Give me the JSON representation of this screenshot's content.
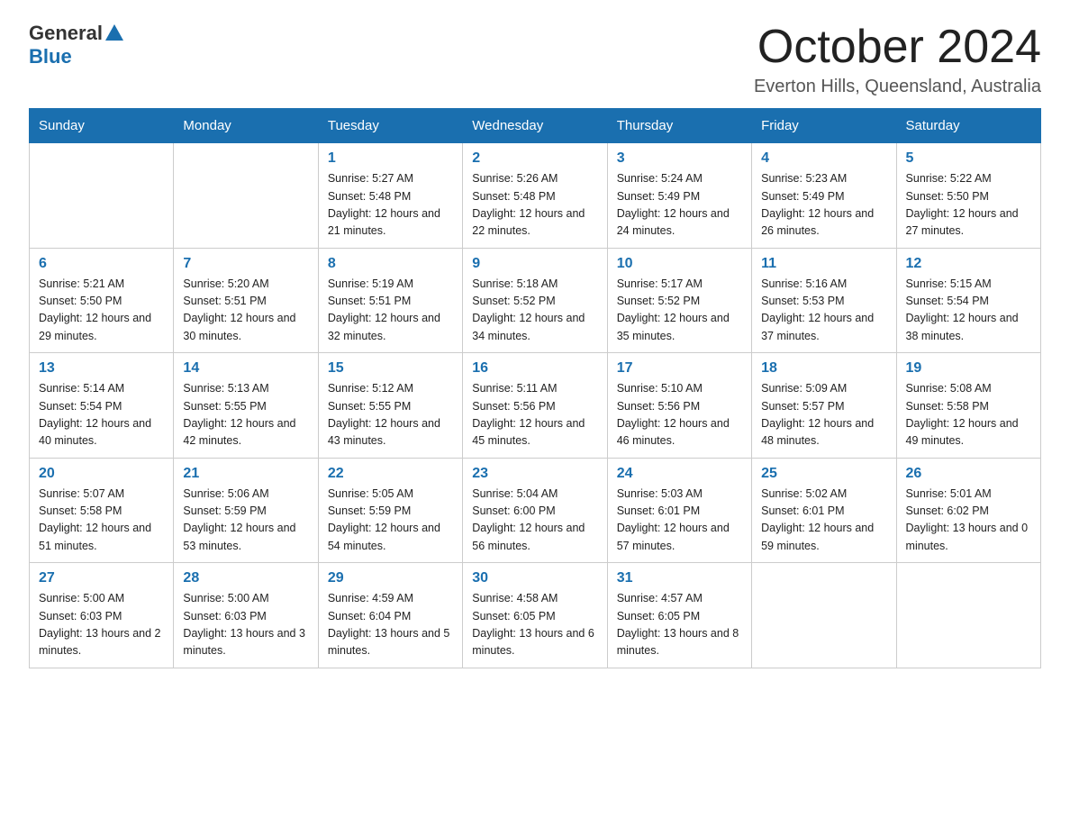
{
  "header": {
    "logo_general": "General",
    "logo_blue": "Blue",
    "month_title": "October 2024",
    "location": "Everton Hills, Queensland, Australia"
  },
  "days_of_week": [
    "Sunday",
    "Monday",
    "Tuesday",
    "Wednesday",
    "Thursday",
    "Friday",
    "Saturday"
  ],
  "weeks": [
    [
      {
        "day": "",
        "info": ""
      },
      {
        "day": "",
        "info": ""
      },
      {
        "day": "1",
        "info": "Sunrise: 5:27 AM\nSunset: 5:48 PM\nDaylight: 12 hours\nand 21 minutes."
      },
      {
        "day": "2",
        "info": "Sunrise: 5:26 AM\nSunset: 5:48 PM\nDaylight: 12 hours\nand 22 minutes."
      },
      {
        "day": "3",
        "info": "Sunrise: 5:24 AM\nSunset: 5:49 PM\nDaylight: 12 hours\nand 24 minutes."
      },
      {
        "day": "4",
        "info": "Sunrise: 5:23 AM\nSunset: 5:49 PM\nDaylight: 12 hours\nand 26 minutes."
      },
      {
        "day": "5",
        "info": "Sunrise: 5:22 AM\nSunset: 5:50 PM\nDaylight: 12 hours\nand 27 minutes."
      }
    ],
    [
      {
        "day": "6",
        "info": "Sunrise: 5:21 AM\nSunset: 5:50 PM\nDaylight: 12 hours\nand 29 minutes."
      },
      {
        "day": "7",
        "info": "Sunrise: 5:20 AM\nSunset: 5:51 PM\nDaylight: 12 hours\nand 30 minutes."
      },
      {
        "day": "8",
        "info": "Sunrise: 5:19 AM\nSunset: 5:51 PM\nDaylight: 12 hours\nand 32 minutes."
      },
      {
        "day": "9",
        "info": "Sunrise: 5:18 AM\nSunset: 5:52 PM\nDaylight: 12 hours\nand 34 minutes."
      },
      {
        "day": "10",
        "info": "Sunrise: 5:17 AM\nSunset: 5:52 PM\nDaylight: 12 hours\nand 35 minutes."
      },
      {
        "day": "11",
        "info": "Sunrise: 5:16 AM\nSunset: 5:53 PM\nDaylight: 12 hours\nand 37 minutes."
      },
      {
        "day": "12",
        "info": "Sunrise: 5:15 AM\nSunset: 5:54 PM\nDaylight: 12 hours\nand 38 minutes."
      }
    ],
    [
      {
        "day": "13",
        "info": "Sunrise: 5:14 AM\nSunset: 5:54 PM\nDaylight: 12 hours\nand 40 minutes."
      },
      {
        "day": "14",
        "info": "Sunrise: 5:13 AM\nSunset: 5:55 PM\nDaylight: 12 hours\nand 42 minutes."
      },
      {
        "day": "15",
        "info": "Sunrise: 5:12 AM\nSunset: 5:55 PM\nDaylight: 12 hours\nand 43 minutes."
      },
      {
        "day": "16",
        "info": "Sunrise: 5:11 AM\nSunset: 5:56 PM\nDaylight: 12 hours\nand 45 minutes."
      },
      {
        "day": "17",
        "info": "Sunrise: 5:10 AM\nSunset: 5:56 PM\nDaylight: 12 hours\nand 46 minutes."
      },
      {
        "day": "18",
        "info": "Sunrise: 5:09 AM\nSunset: 5:57 PM\nDaylight: 12 hours\nand 48 minutes."
      },
      {
        "day": "19",
        "info": "Sunrise: 5:08 AM\nSunset: 5:58 PM\nDaylight: 12 hours\nand 49 minutes."
      }
    ],
    [
      {
        "day": "20",
        "info": "Sunrise: 5:07 AM\nSunset: 5:58 PM\nDaylight: 12 hours\nand 51 minutes."
      },
      {
        "day": "21",
        "info": "Sunrise: 5:06 AM\nSunset: 5:59 PM\nDaylight: 12 hours\nand 53 minutes."
      },
      {
        "day": "22",
        "info": "Sunrise: 5:05 AM\nSunset: 5:59 PM\nDaylight: 12 hours\nand 54 minutes."
      },
      {
        "day": "23",
        "info": "Sunrise: 5:04 AM\nSunset: 6:00 PM\nDaylight: 12 hours\nand 56 minutes."
      },
      {
        "day": "24",
        "info": "Sunrise: 5:03 AM\nSunset: 6:01 PM\nDaylight: 12 hours\nand 57 minutes."
      },
      {
        "day": "25",
        "info": "Sunrise: 5:02 AM\nSunset: 6:01 PM\nDaylight: 12 hours\nand 59 minutes."
      },
      {
        "day": "26",
        "info": "Sunrise: 5:01 AM\nSunset: 6:02 PM\nDaylight: 13 hours\nand 0 minutes."
      }
    ],
    [
      {
        "day": "27",
        "info": "Sunrise: 5:00 AM\nSunset: 6:03 PM\nDaylight: 13 hours\nand 2 minutes."
      },
      {
        "day": "28",
        "info": "Sunrise: 5:00 AM\nSunset: 6:03 PM\nDaylight: 13 hours\nand 3 minutes."
      },
      {
        "day": "29",
        "info": "Sunrise: 4:59 AM\nSunset: 6:04 PM\nDaylight: 13 hours\nand 5 minutes."
      },
      {
        "day": "30",
        "info": "Sunrise: 4:58 AM\nSunset: 6:05 PM\nDaylight: 13 hours\nand 6 minutes."
      },
      {
        "day": "31",
        "info": "Sunrise: 4:57 AM\nSunset: 6:05 PM\nDaylight: 13 hours\nand 8 minutes."
      },
      {
        "day": "",
        "info": ""
      },
      {
        "day": "",
        "info": ""
      }
    ]
  ]
}
